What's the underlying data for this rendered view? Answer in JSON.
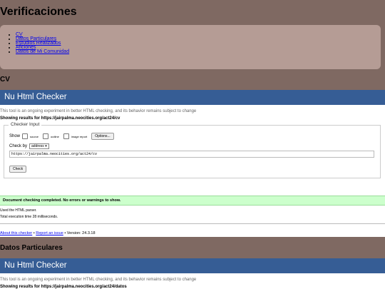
{
  "page": {
    "title": "Verificaciones"
  },
  "nav": {
    "items": [
      {
        "label": "CV"
      },
      {
        "label": "Datos Particulares"
      },
      {
        "label": "Estudios Realizados"
      },
      {
        "label": "Aficiones"
      },
      {
        "label": "Datos de Mi Comunidad"
      }
    ]
  },
  "sections": {
    "cv": {
      "heading": "CV"
    },
    "particulares": {
      "heading": "Datos Particulares"
    }
  },
  "checker": {
    "title": "Nu Html Checker",
    "intro": "This tool is an ongoing experiment in better HTML checking, and its behavior remains subject to change",
    "showing": "Showing results for https://jairpalma.neocities.org/act24/cv",
    "showing2": "Showing results for https://jairpalma.neocities.org/act24/datos",
    "legend": "Checker Input",
    "show_label": "Show",
    "opt_source": "source",
    "opt_outline": "outline",
    "opt_image": "image report",
    "options_btn": "Options...",
    "check_by_label": "Check by",
    "check_by_value": "address",
    "url_value": "https://jairpalma.neocities.org/act24/cv",
    "check_btn": "Check",
    "success": "Document checking completed. No errors or warnings to show.",
    "parser": "Used the HTML parser.",
    "exec_time": "Total execution time 28 milliseconds.",
    "about_link": "About this checker",
    "bullet": "•",
    "report_link": "Report an issue",
    "version": "• Version: 24.3.18"
  }
}
